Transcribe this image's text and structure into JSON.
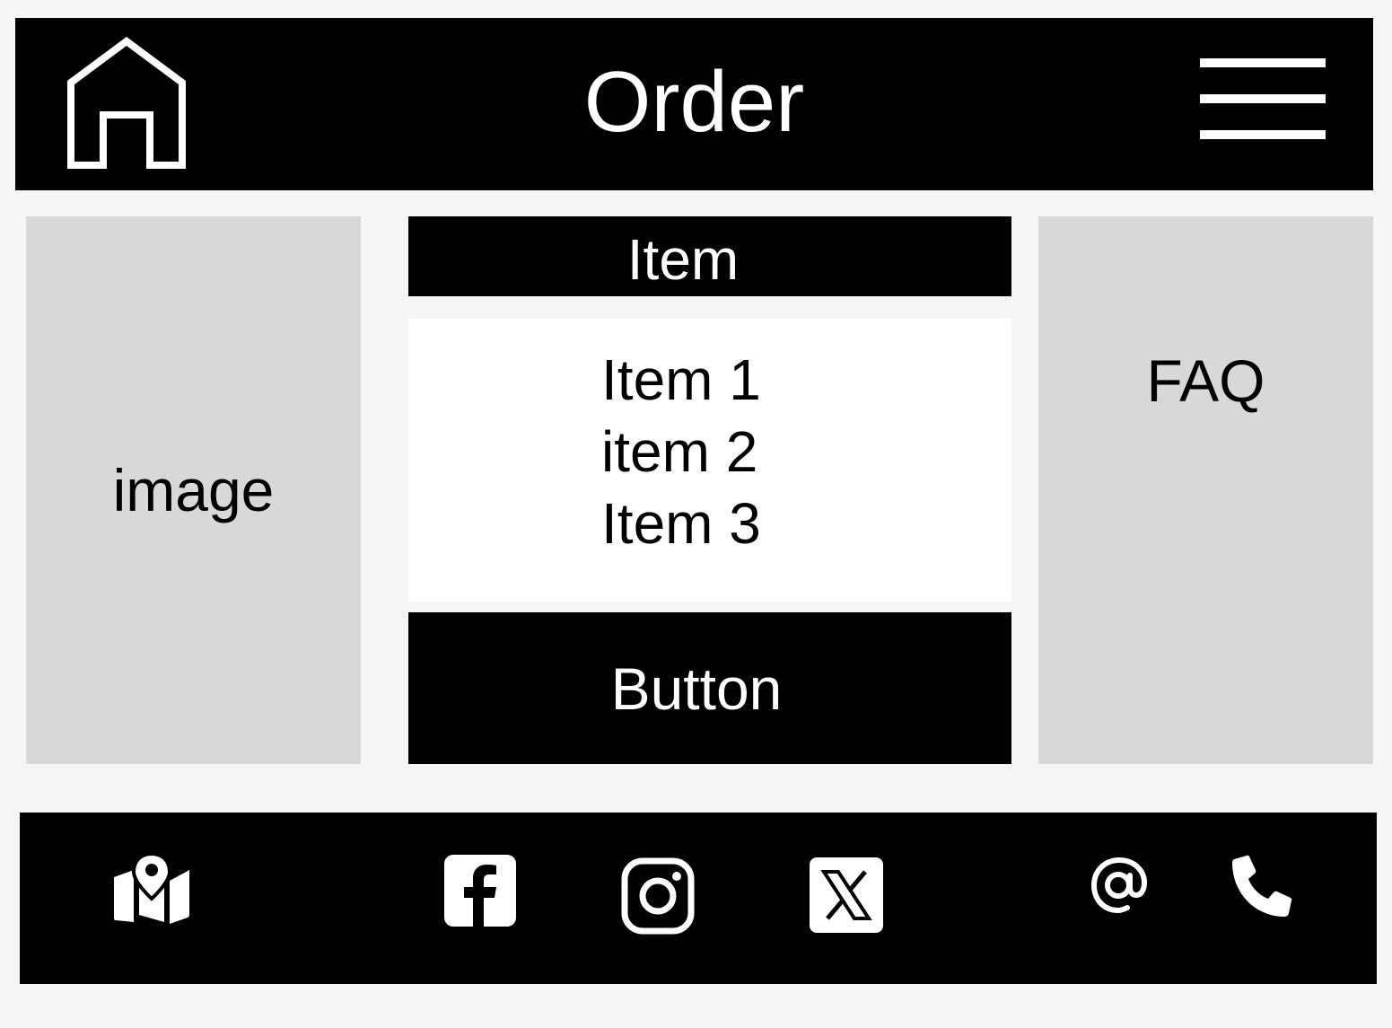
{
  "header": {
    "title": "Order",
    "home_icon": "home-icon",
    "menu_icon": "hamburger-menu-icon"
  },
  "left_panel": {
    "label": "image"
  },
  "center": {
    "item_header": "Item",
    "items": [
      "Item 1",
      "item 2",
      "Item 3"
    ],
    "button_label": "Button"
  },
  "right_panel": {
    "label": "FAQ"
  },
  "footer": {
    "icons": [
      "map-location-icon",
      "facebook-icon",
      "instagram-icon",
      "x-twitter-icon",
      "email-at-icon",
      "phone-icon"
    ]
  },
  "colors": {
    "background": "#f5f5f5",
    "bar": "#000000",
    "panel": "#d8d8d8",
    "list_background": "#ffffff"
  }
}
